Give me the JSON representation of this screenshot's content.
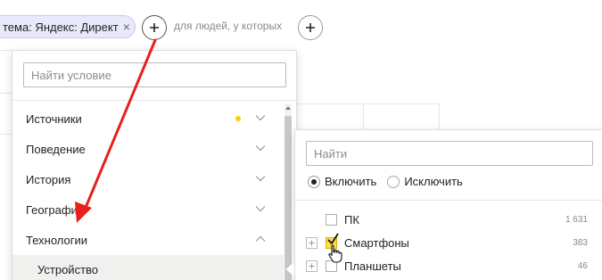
{
  "filter_bar": {
    "chip_label": "тема: Яндекс: Директ",
    "chip_close": "×",
    "for_people_text": "для людей, у которых"
  },
  "dropdown": {
    "search_placeholder": "Найти условие",
    "categories": [
      {
        "label": "Источники",
        "has_dot": true,
        "chevron": "down"
      },
      {
        "label": "Поведение",
        "chevron": "down"
      },
      {
        "label": "История",
        "chevron": "down"
      },
      {
        "label": "География",
        "chevron": "down"
      },
      {
        "label": "Технологии",
        "chevron": "up",
        "expanded": true
      }
    ],
    "selected_subitem": "Устройство"
  },
  "device_panel": {
    "search_placeholder": "Найти",
    "include_label": "Включить",
    "exclude_label": "Исключить",
    "selected_mode": "include",
    "devices": [
      {
        "label": "ПК",
        "count": "1 631",
        "checked": false,
        "expandable": false
      },
      {
        "label": "Смартфоны",
        "count": "383",
        "checked": true,
        "expandable": true
      },
      {
        "label": "Планшеты",
        "count": "46",
        "checked": false,
        "expandable": true
      }
    ]
  },
  "colors": {
    "chip_bg": "#e9e9fb",
    "dot_yellow": "#ffcc00",
    "checkbox_checked": "#ffdb4d",
    "arrow_red": "#e8201a"
  },
  "icons": {
    "plus": "plus-icon",
    "chevron": "chevron-icon",
    "cursor": "hand-pointer-icon"
  }
}
